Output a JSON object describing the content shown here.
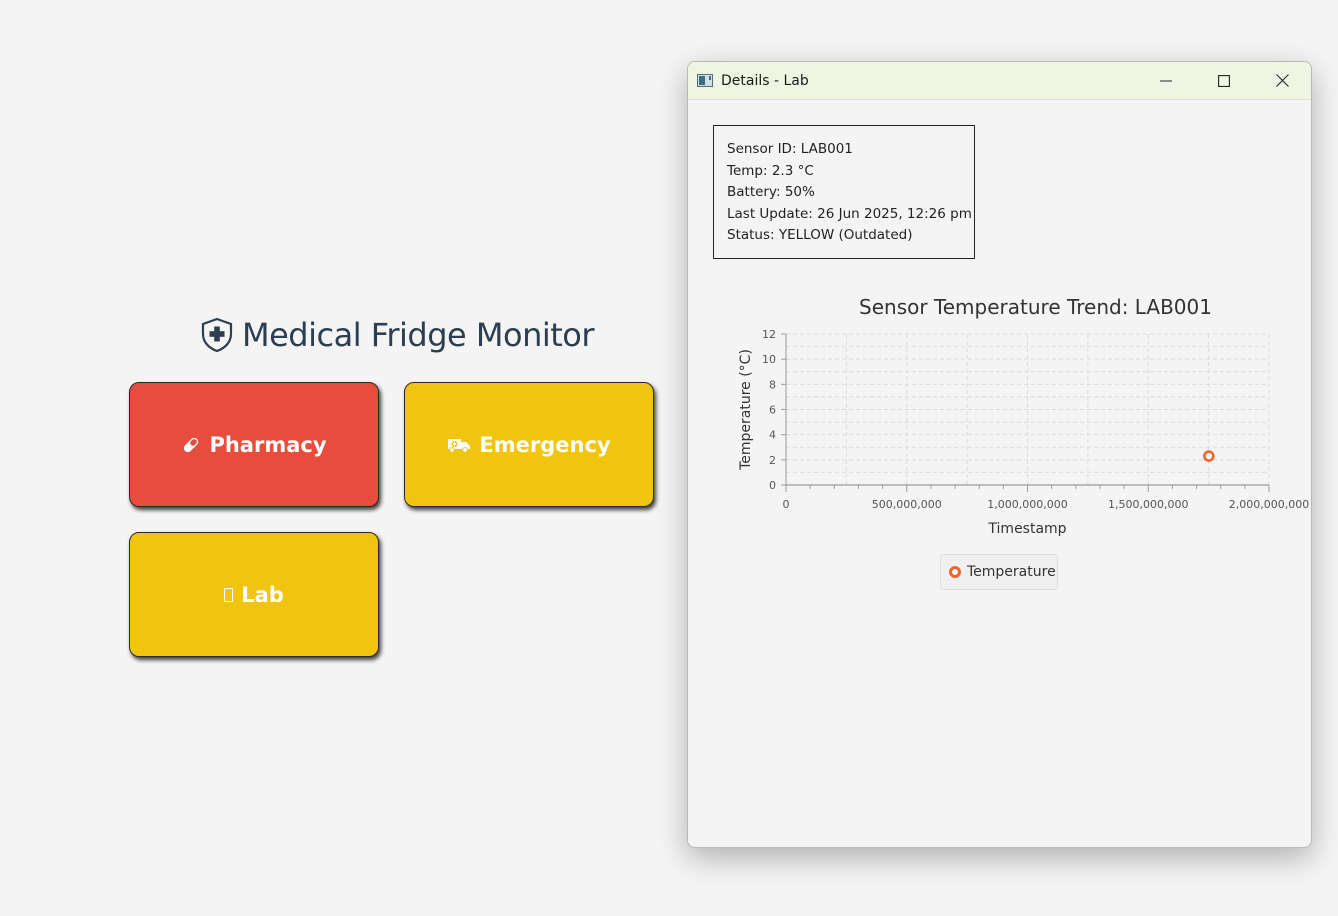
{
  "main": {
    "title": "Medical Fridge Monitor",
    "tiles": [
      {
        "label": "Pharmacy",
        "color": "#e74c3c",
        "icon": "pill-icon"
      },
      {
        "label": "Emergency",
        "color": "#f1c40f",
        "icon": "ambulance-icon"
      },
      {
        "label": "Lab",
        "color": "#f1c40f",
        "icon": "missing-glyph-icon"
      }
    ]
  },
  "details_window": {
    "title": "Details - Lab",
    "info": {
      "sensor_id": "Sensor ID: LAB001",
      "temp": "Temp: 2.3 °C",
      "battery": "Battery: 50%",
      "last_update": "Last Update: 26 Jun 2025, 12:26 pm",
      "status": "Status: YELLOW (Outdated)"
    },
    "legend_label": "Temperature"
  },
  "chart_data": {
    "type": "scatter",
    "title": "Sensor Temperature Trend: LAB001",
    "xlabel": "Timestamp",
    "ylabel": "Temperature (°C)",
    "xlim": [
      0,
      2000000000
    ],
    "ylim": [
      0,
      12
    ],
    "x_ticks": [
      "0",
      "500,000,000",
      "1,000,000,000",
      "1,500,000,000",
      "2,000,000,000"
    ],
    "y_ticks": [
      "0",
      "2",
      "4",
      "6",
      "8",
      "10",
      "12"
    ],
    "grid": true,
    "legend_position": "bottom",
    "series": [
      {
        "name": "Temperature",
        "color": "#f3622d",
        "points": [
          {
            "x": 1750940000,
            "y": 2.3
          }
        ]
      }
    ]
  }
}
